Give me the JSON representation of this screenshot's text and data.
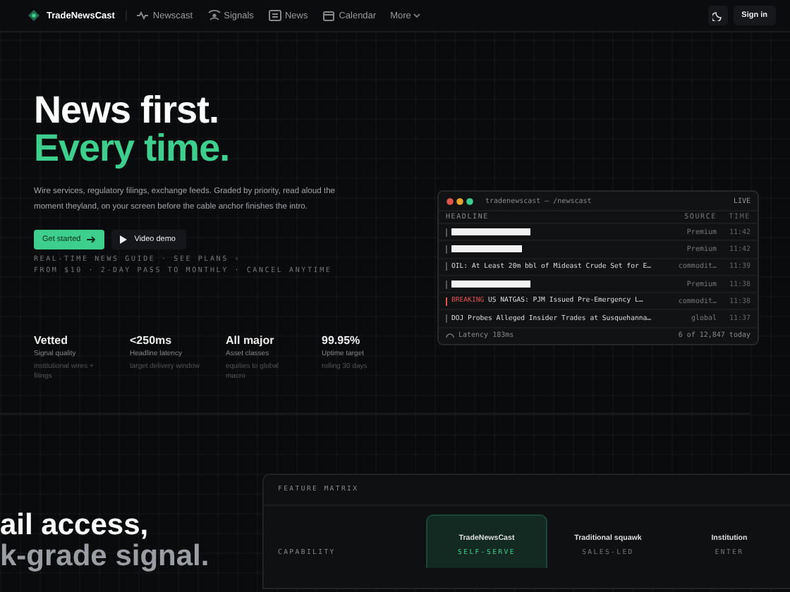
{
  "nav": {
    "brand": "TradeNewsCast",
    "links": [
      {
        "label": "Newscast"
      },
      {
        "label": "Signals"
      },
      {
        "label": "News"
      },
      {
        "label": "Calendar"
      },
      {
        "label": "More"
      }
    ],
    "sign_in": "Sign in"
  },
  "hero": {
    "title_1": "News first.",
    "title_2": "Every time.",
    "lead": "Wire services, regulatory filings, exchange feeds. Graded by priority, read aloud the moment theyland, on your screen before the cable anchor finishes the intro.",
    "primary": "Get started",
    "secondary": "Video demo",
    "meta_1": "REAL-TIME NEWS GUIDE · SEE PLANS ›",
    "meta_2": "FROM $10 · 2-DAY PASS TO MONTHLY · CANCEL ANYTIME"
  },
  "stats": [
    {
      "value": "Vetted",
      "label": "Signal quality",
      "note": "institutional wires + filings"
    },
    {
      "value": "<250ms",
      "label": "Headline latency",
      "note": "target delivery window"
    },
    {
      "value": "All major",
      "label": "Asset classes",
      "note": "equities to global macro"
    },
    {
      "value": "99.95%",
      "label": "Uptime target",
      "note": "rolling 30 days"
    }
  ],
  "terminal": {
    "title": "tradenewscast — /newscast",
    "status": "LIVE",
    "columns": [
      "HEADLINE",
      "SOURCE",
      "TIME"
    ],
    "rows": [
      {
        "kind": "redacted",
        "source": "Premium",
        "time": "11:42"
      },
      {
        "kind": "redacted",
        "source": "Premium",
        "time": "11:42"
      },
      {
        "kind": "text",
        "headline": "OIL: At Least 20m bbl of Mideast Crude Set for E…",
        "source": "commodit…",
        "time": "11:39"
      },
      {
        "kind": "redacted",
        "source": "Premium",
        "time": "11:38"
      },
      {
        "kind": "breaking",
        "tag": "BREAKING",
        "headline": "US NATGAS: PJM Issued Pre-Emergency L…",
        "source": "commodit…",
        "time": "11:38"
      },
      {
        "kind": "text",
        "headline": "DOJ Probes Alleged Insider Trades at Susquehanna…",
        "source": "global",
        "time": "11:37"
      }
    ],
    "latency": "Latency 183ms",
    "count": "6 of 12,847 today"
  },
  "section": {
    "heading_1": "ail access,",
    "heading_2": "k-grade signal."
  },
  "matrix": {
    "title": "FEATURE MATRIX",
    "capability": "CAPABILITY",
    "columns": [
      {
        "name": "TradeNewsCast",
        "tag": "SELF-SERVE",
        "selected": true
      },
      {
        "name": "Traditional squawk",
        "tag": "SALES-LED",
        "selected": false
      },
      {
        "name": "Institution",
        "tag": "ENTER",
        "selected": false
      }
    ]
  }
}
